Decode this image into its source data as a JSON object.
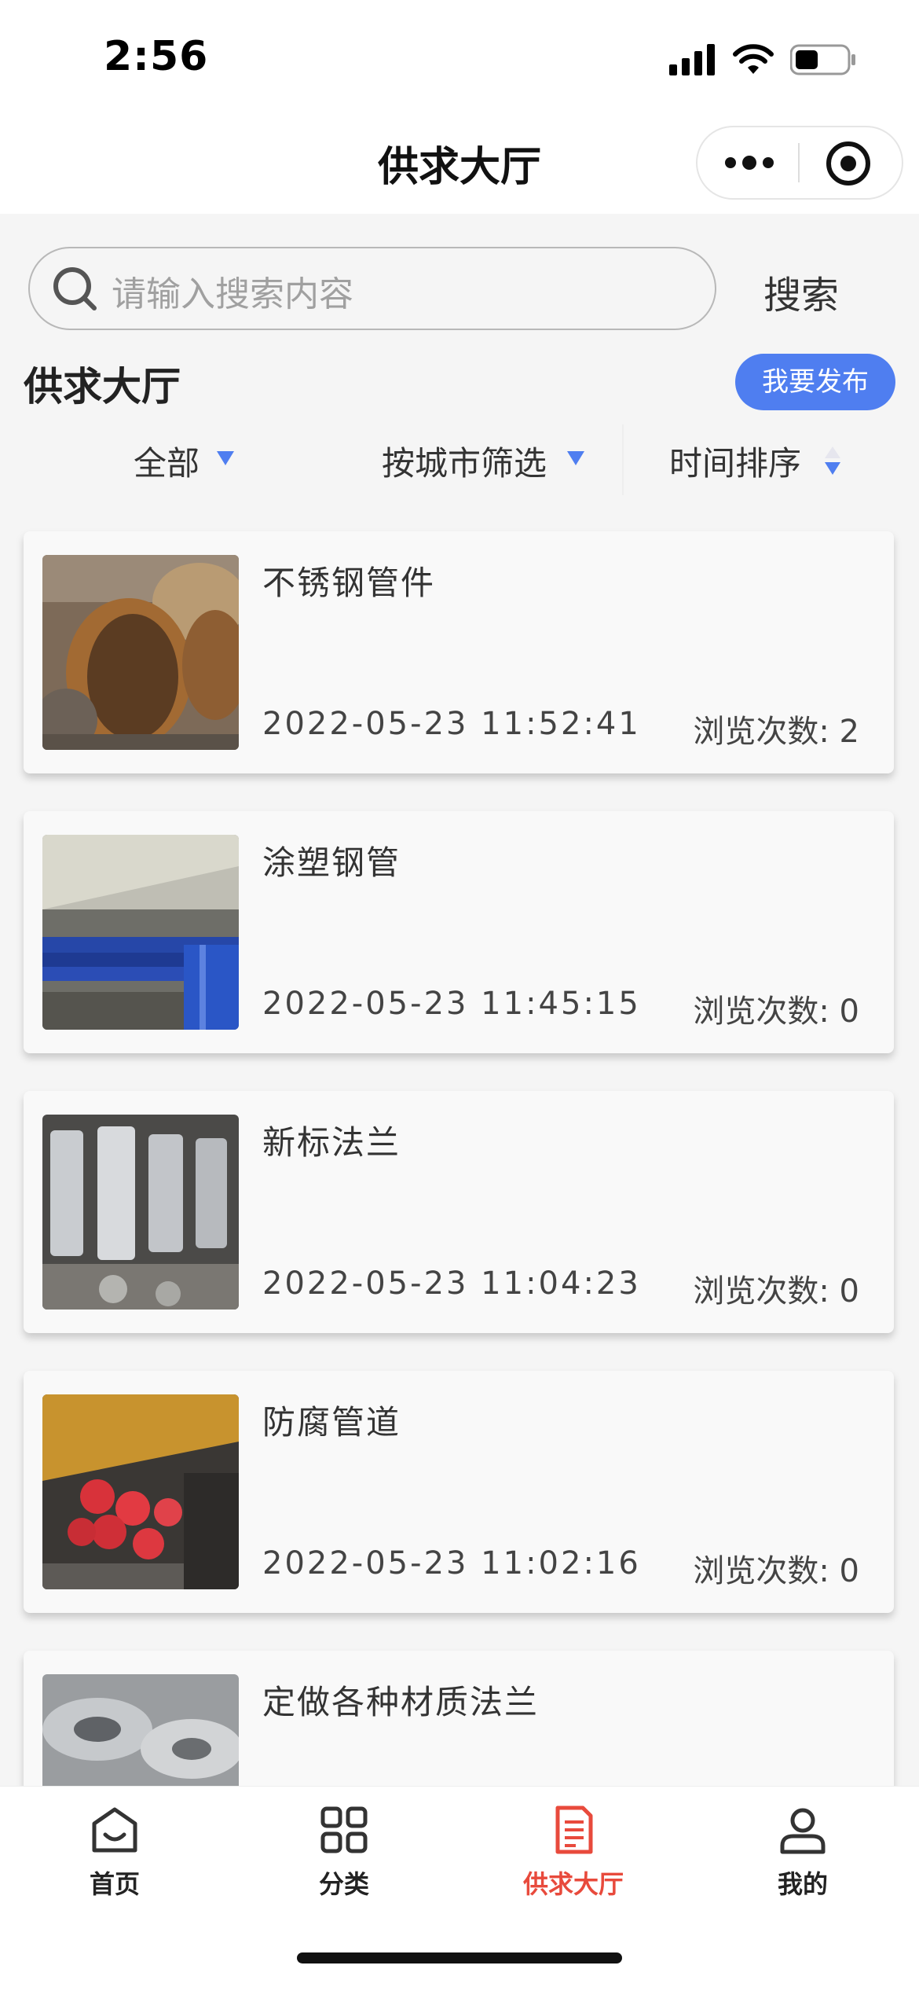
{
  "status_bar": {
    "time": "2:56"
  },
  "nav": {
    "title": "供求大厅"
  },
  "search": {
    "placeholder": "请输入搜索内容",
    "button_label": "搜索"
  },
  "section": {
    "title": "供求大厅",
    "publish_label": "我要发布"
  },
  "filters": {
    "all_label": "全部",
    "city_label": "按城市筛选",
    "sort_label": "时间排序"
  },
  "views_prefix": "浏览次数: ",
  "listings": [
    {
      "title": "不锈钢管件",
      "date": "2022-05-23 11:52:41",
      "views": "浏览次数: 2"
    },
    {
      "title": "涂塑钢管",
      "date": "2022-05-23 11:45:15",
      "views": "浏览次数: 0"
    },
    {
      "title": "新标法兰",
      "date": "2022-05-23 11:04:23",
      "views": "浏览次数: 0"
    },
    {
      "title": "防腐管道",
      "date": "2022-05-23 11:02:16",
      "views": "浏览次数: 0"
    },
    {
      "title": "定做各种材质法兰"
    }
  ],
  "tabbar": {
    "items": [
      {
        "label": "首页",
        "icon": "home-icon"
      },
      {
        "label": "分类",
        "icon": "grid-icon"
      },
      {
        "label": "供求大厅",
        "icon": "document-icon",
        "active": true
      },
      {
        "label": "我的",
        "icon": "user-icon"
      }
    ],
    "active_color": "#e84a3c"
  },
  "colors": {
    "accent": "#4f7ef0",
    "active_tab": "#e84a3c"
  }
}
